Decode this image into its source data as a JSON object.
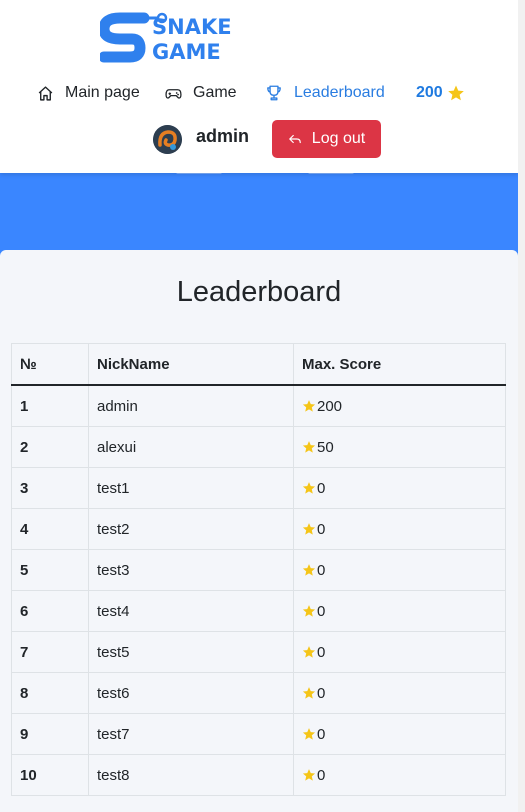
{
  "header": {
    "logo_line1": "SNAKE",
    "logo_line2": "GAME",
    "nav": [
      {
        "label": "Main page",
        "icon": "home-icon"
      },
      {
        "label": "Game",
        "icon": "gamepad-icon"
      },
      {
        "label": "Leaderboard",
        "icon": "trophy-icon",
        "active": true
      }
    ],
    "score": "200",
    "username": "admin",
    "logout_label": "Log out"
  },
  "leaderboard": {
    "title": "Leaderboard",
    "columns": [
      "№",
      "NickName",
      "Max. Score"
    ],
    "rows": [
      {
        "rank": "1",
        "nick": "admin",
        "score": "200"
      },
      {
        "rank": "2",
        "nick": "alexui",
        "score": "50"
      },
      {
        "rank": "3",
        "nick": "test1",
        "score": "0"
      },
      {
        "rank": "4",
        "nick": "test2",
        "score": "0"
      },
      {
        "rank": "5",
        "nick": "test3",
        "score": "0"
      },
      {
        "rank": "6",
        "nick": "test4",
        "score": "0"
      },
      {
        "rank": "7",
        "nick": "test5",
        "score": "0"
      },
      {
        "rank": "8",
        "nick": "test6",
        "score": "0"
      },
      {
        "rank": "9",
        "nick": "test7",
        "score": "0"
      },
      {
        "rank": "10",
        "nick": "test8",
        "score": "0"
      }
    ]
  },
  "colors": {
    "accent": "#2a7de1",
    "hero": "#3a86ff",
    "danger": "#dc3545",
    "star": "#f5c518",
    "logo": "#2f80ed"
  }
}
